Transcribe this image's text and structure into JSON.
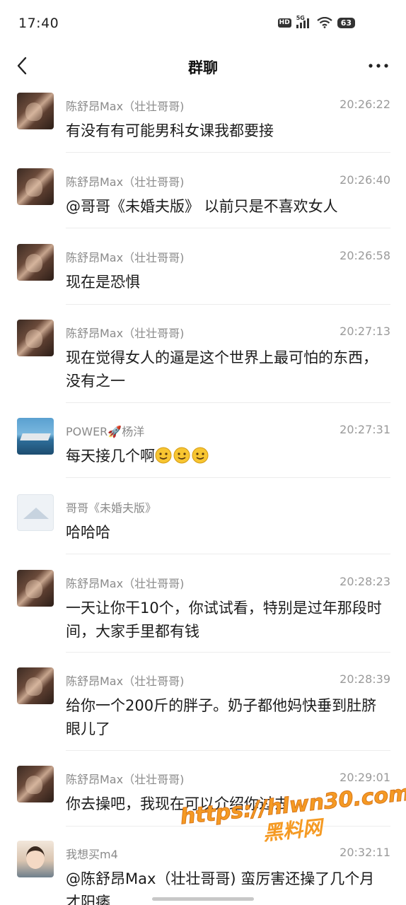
{
  "status_bar": {
    "time": "17:40",
    "hd_label": "HD",
    "network_label": "5G",
    "battery_level": "63"
  },
  "nav": {
    "title": "群聊",
    "back_icon": "chevron-left-icon",
    "more_icon": "more-horizontal-icon"
  },
  "messages": [
    {
      "sender": "陈舒昂Max（壮壮哥哥)",
      "time": "20:26:22",
      "text": "有没有有可能男科女课我都要接",
      "avatar": "muscle-avatar"
    },
    {
      "sender": "陈舒昂Max（壮壮哥哥)",
      "time": "20:26:40",
      "text": "@哥哥《未婚夫版》 以前只是不喜欢女人",
      "avatar": "muscle-avatar"
    },
    {
      "sender": "陈舒昂Max（壮壮哥哥)",
      "time": "20:26:58",
      "text": "现在是恐惧",
      "avatar": "muscle-avatar"
    },
    {
      "sender": "陈舒昂Max（壮壮哥哥)",
      "time": "20:27:13",
      "text": "现在觉得女人的逼是这个世界上最可怕的东西，没有之一",
      "avatar": "muscle-avatar"
    },
    {
      "sender": "POWER🚀杨洋",
      "time": "20:27:31",
      "text": "每天接几个啊",
      "emoji_count": 3,
      "avatar": "ship-avatar"
    },
    {
      "sender": "哥哥《未婚夫版》",
      "time": "",
      "text": "哈哈哈",
      "avatar": "blank-avatar"
    },
    {
      "sender": "陈舒昂Max（壮壮哥哥)",
      "time": "20:28:23",
      "text": "一天让你干10个，你试试看，特别是过年那段时间，大家手里都有钱",
      "avatar": "muscle-avatar"
    },
    {
      "sender": "陈舒昂Max（壮壮哥哥)",
      "time": "20:28:39",
      "text": "给你一个200斤的胖子。奶子都他妈快垂到肚脐眼儿了",
      "avatar": "muscle-avatar"
    },
    {
      "sender": "陈舒昂Max（壮壮哥哥)",
      "time": "20:29:01",
      "text": "你去操吧，我现在可以介绍你过去",
      "avatar": "muscle-avatar"
    },
    {
      "sender": "我想买m4",
      "time": "20:32:11",
      "text": "@陈舒昂Max（壮壮哥哥) 蛮厉害还操了几个月才阳痿",
      "avatar": "child-avatar"
    }
  ],
  "watermark": {
    "url": "https://hlwn30.com",
    "name": "黑料网"
  },
  "colors": {
    "accent_watermark": "#f59a23",
    "meta_text": "#8a8a8a",
    "body_text": "#1b1b1b"
  }
}
